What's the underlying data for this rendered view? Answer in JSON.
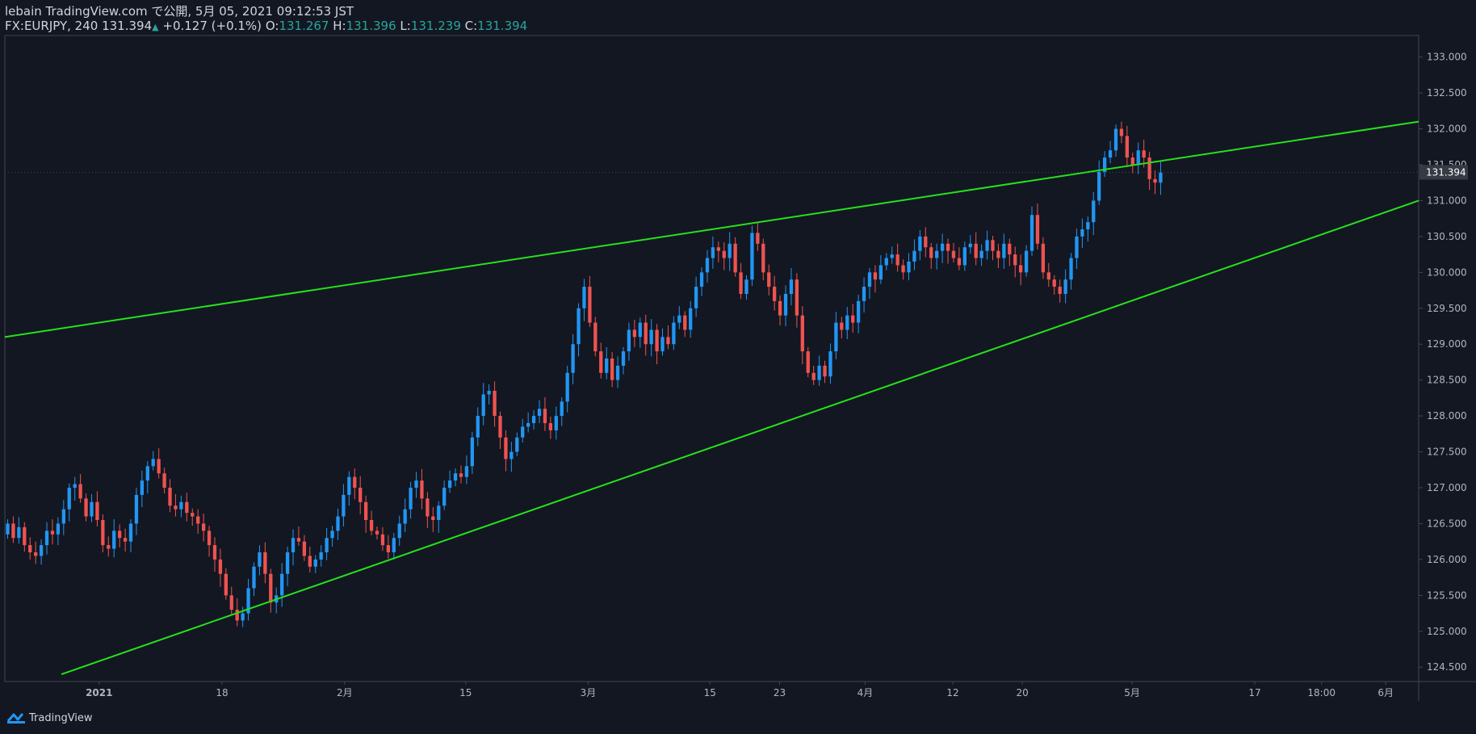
{
  "header": {
    "published": "lebain TradingView.com で公開, 5月 05, 2021 09:12:53 JST",
    "symbol": "FX:EURJPY, 240",
    "last": "131.394",
    "change": "+0.127 (+0.1%)",
    "o_label": "O:",
    "o_value": "131.267",
    "h_label": "H:",
    "h_value": "131.396",
    "l_label": "L:",
    "l_value": "131.239",
    "c_label": "C:",
    "c_value": "131.394"
  },
  "footer": {
    "brand": "TradingView"
  },
  "colors": {
    "background": "#131722",
    "up": "#2196f3",
    "down": "#ef5350",
    "trendline": "#26e11c",
    "axis_text": "#b2b5be",
    "grid_border": "#787b86"
  },
  "chart_data": {
    "type": "candlestick",
    "symbol": "FX:EURJPY",
    "interval": "240",
    "current_price": 131.394,
    "y_ticks": [
      124.5,
      125.0,
      125.5,
      126.0,
      126.5,
      127.0,
      127.5,
      128.0,
      128.5,
      129.0,
      129.5,
      130.0,
      130.5,
      131.0,
      131.5,
      132.0,
      132.5,
      133.0
    ],
    "y_tick_labels": [
      "124.500",
      "125.000",
      "125.500",
      "126.000",
      "126.500",
      "127.000",
      "127.500",
      "128.000",
      "128.500",
      "129.000",
      "129.500",
      "130.000",
      "130.500",
      "131.000",
      "131.500",
      "132.000",
      "132.500",
      "133.000"
    ],
    "ylim": [
      124.3,
      133.3
    ],
    "x_ticks": [
      {
        "label": "2021",
        "pos": 0.0667,
        "bold": true
      },
      {
        "label": "18",
        "pos": 0.1536
      },
      {
        "label": "2月",
        "pos": 0.2403
      },
      {
        "label": "15",
        "pos": 0.326
      },
      {
        "label": "3月",
        "pos": 0.4126
      },
      {
        "label": "15",
        "pos": 0.4987
      },
      {
        "label": "23",
        "pos": 0.548
      },
      {
        "label": "4月",
        "pos": 0.6085
      },
      {
        "label": "12",
        "pos": 0.6705
      },
      {
        "label": "20",
        "pos": 0.7197
      },
      {
        "label": "5月",
        "pos": 0.7973
      },
      {
        "label": "17",
        "pos": 0.8841
      },
      {
        "label": "18:00",
        "pos": 0.9313
      },
      {
        "label": "6月",
        "pos": 0.9767
      }
    ],
    "trendlines": [
      {
        "name": "upper",
        "from": [
          0.0,
          129.1
        ],
        "to": [
          1.0,
          132.1
        ]
      },
      {
        "name": "lower",
        "from": [
          0.04,
          124.4
        ],
        "to": [
          1.0,
          131.0
        ]
      }
    ],
    "closes": [
      126.5,
      126.3,
      126.45,
      126.2,
      126.1,
      126.05,
      126.2,
      126.4,
      126.35,
      126.5,
      126.7,
      127.0,
      127.05,
      126.85,
      126.6,
      126.8,
      126.55,
      126.2,
      126.15,
      126.4,
      126.3,
      126.25,
      126.5,
      126.9,
      127.1,
      127.3,
      127.4,
      127.2,
      127.0,
      126.75,
      126.7,
      126.8,
      126.65,
      126.6,
      126.5,
      126.4,
      126.2,
      126.0,
      125.8,
      125.5,
      125.3,
      125.15,
      125.25,
      125.6,
      125.9,
      126.1,
      125.8,
      125.4,
      125.5,
      125.8,
      126.1,
      126.3,
      126.25,
      126.05,
      125.9,
      126.0,
      126.1,
      126.3,
      126.4,
      126.6,
      126.9,
      127.15,
      127.0,
      126.8,
      126.55,
      126.4,
      126.35,
      126.2,
      126.1,
      126.3,
      126.5,
      126.7,
      127.0,
      127.1,
      126.85,
      126.6,
      126.55,
      126.75,
      127.0,
      127.1,
      127.2,
      127.15,
      127.3,
      127.7,
      128.0,
      128.3,
      128.35,
      128.0,
      127.7,
      127.4,
      127.5,
      127.7,
      127.85,
      127.9,
      128.0,
      128.1,
      127.9,
      127.8,
      128.0,
      128.2,
      128.6,
      129.0,
      129.5,
      129.8,
      129.3,
      128.9,
      128.6,
      128.8,
      128.5,
      128.7,
      128.9,
      129.2,
      129.1,
      129.3,
      129.0,
      129.2,
      128.9,
      129.1,
      129.0,
      129.3,
      129.4,
      129.2,
      129.5,
      129.8,
      130.0,
      130.2,
      130.35,
      130.3,
      130.2,
      130.4,
      130.0,
      129.7,
      129.9,
      130.55,
      130.4,
      130.0,
      129.8,
      129.6,
      129.4,
      129.7,
      129.9,
      129.4,
      128.9,
      128.6,
      128.5,
      128.7,
      128.55,
      128.9,
      129.3,
      129.2,
      129.4,
      129.3,
      129.6,
      129.8,
      130.0,
      129.9,
      130.1,
      130.2,
      130.25,
      130.1,
      130.0,
      130.15,
      130.3,
      130.5,
      130.35,
      130.2,
      130.3,
      130.4,
      130.3,
      130.2,
      130.1,
      130.35,
      130.4,
      130.2,
      130.3,
      130.45,
      130.3,
      130.2,
      130.4,
      130.25,
      130.1,
      130.0,
      130.3,
      130.8,
      130.4,
      130.0,
      129.9,
      129.8,
      129.7,
      129.9,
      130.2,
      130.5,
      130.6,
      130.7,
      131.0,
      131.4,
      131.6,
      131.7,
      132.0,
      131.9,
      131.6,
      131.5,
      131.7,
      131.6,
      131.3,
      131.25,
      131.39
    ]
  }
}
